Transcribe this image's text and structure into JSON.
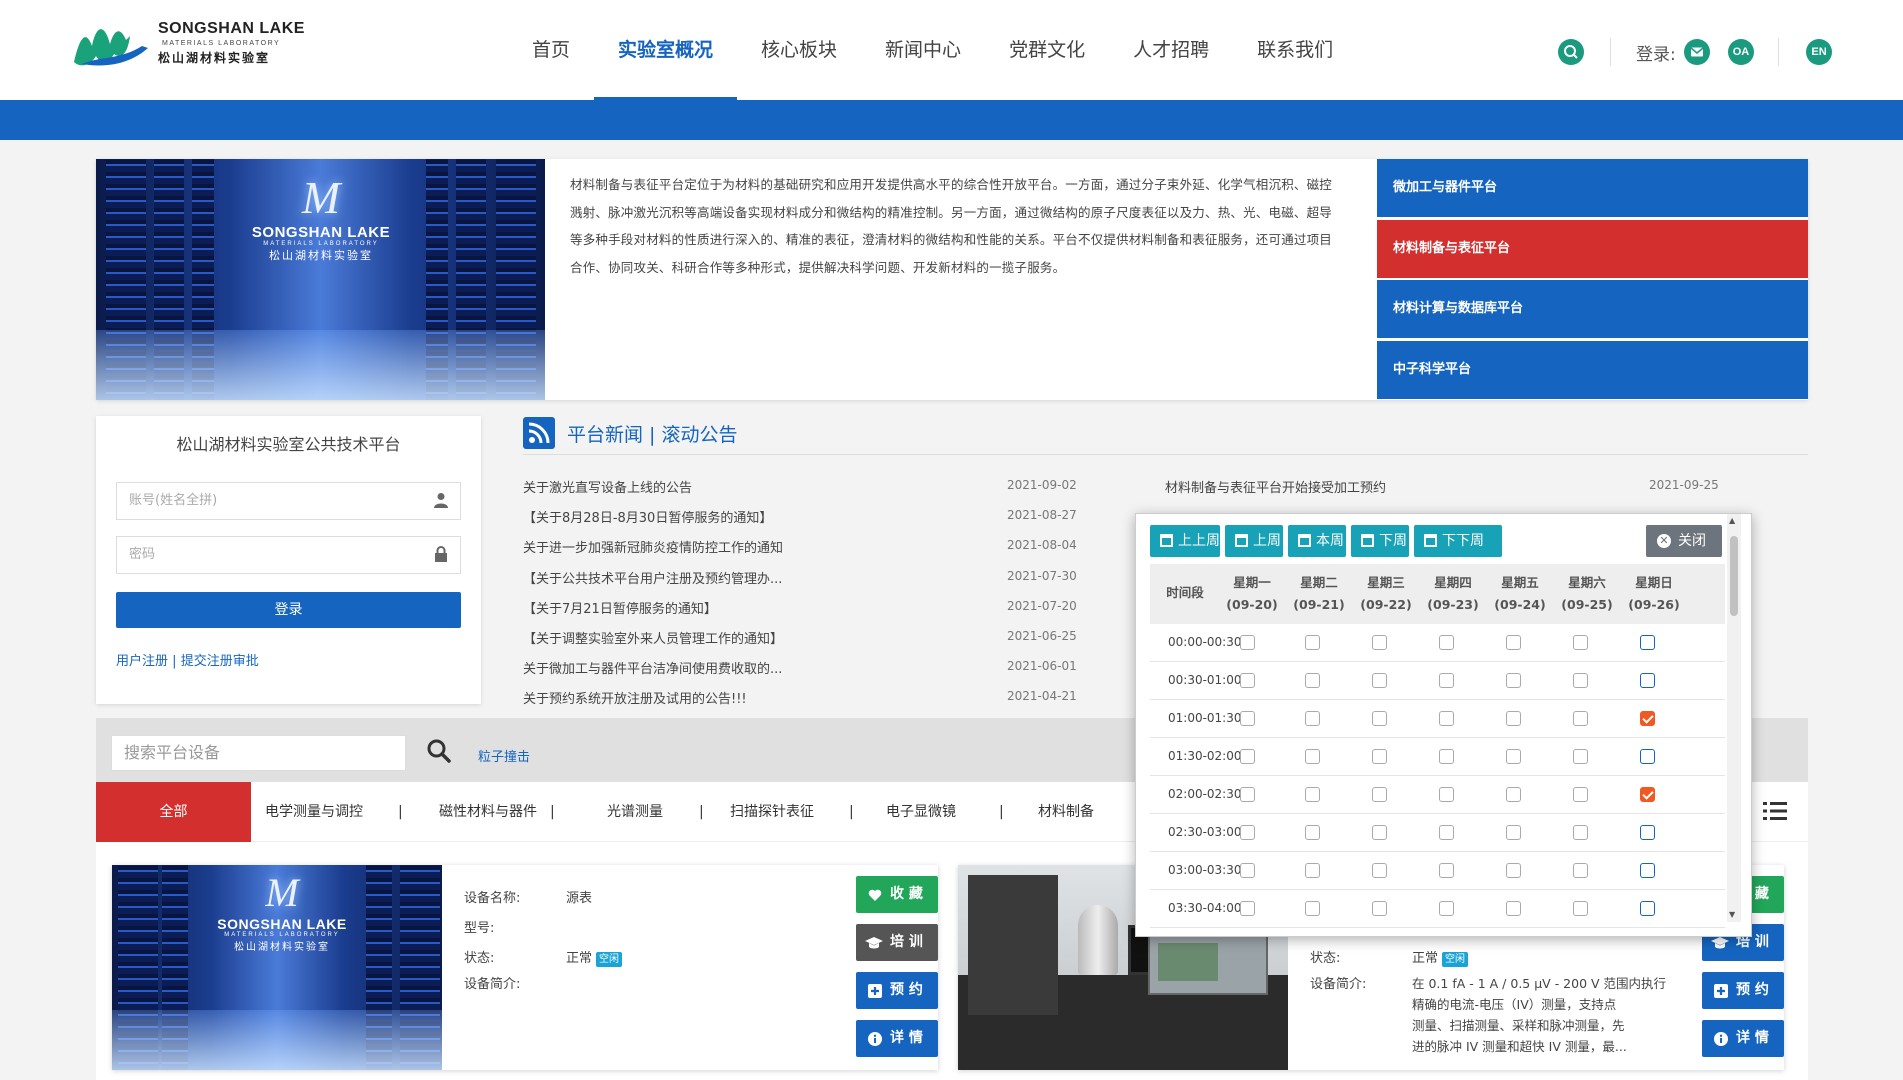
{
  "header": {
    "logo_en": "SONGSHAN LAKE",
    "logo_sub": "MATERIALS LABORATORY",
    "logo_cn": "松山湖材料实验室",
    "nav": [
      "首页",
      "实验室概况",
      "核心板块",
      "新闻中心",
      "党群文化",
      "人才招聘",
      "联系我们"
    ],
    "nav_active": "实验室概况",
    "login_label": "登录:",
    "oa_label": "OA",
    "lang_label": "EN"
  },
  "intro": {
    "image_en": "SONGSHAN LAKE",
    "image_sub": "MATERIALS LABORATORY",
    "image_cn": "松山湖材料实验室",
    "text": "材料制备与表征平台定位于为材料的基础研究和应用开发提供高水平的综合性开放平台。一方面，通过分子束外延、化学气相沉积、磁控溅射、脉冲激光沉积等高端设备实现材料成分和微结构的精准控制。另一方面，通过微结构的原子尺度表征以及力、热、光、电磁、超导等多种手段对材料的性质进行深入的、精准的表征，澄清材料的微结构和性能的关系。平台不仅提供材料制备和表征服务，还可通过项目合作、协同攻关、科研合作等多种形式，提供解决科学问题、开发新材料的一揽子服务。",
    "platforms": [
      "微加工与器件平台",
      "材料制备与表征平台",
      "材料计算与数据库平台",
      "中子科学平台"
    ],
    "active_platform": "材料制备与表征平台"
  },
  "login": {
    "title": "松山湖材料实验室公共技术平台",
    "account_placeholder": "账号(姓名全拼)",
    "password_placeholder": "密码",
    "login_button": "登录",
    "register_link": "用户注册",
    "approve_link": "提交注册审批",
    "link_sep": "|"
  },
  "news": {
    "title": "平台新闻 | 滚动公告",
    "items": [
      {
        "title": "关于激光直写设备上线的公告",
        "date": "2021-09-02"
      },
      {
        "title": "【关于8月28日-8月30日暂停服务的通知】",
        "date": "2021-08-27"
      },
      {
        "title": "关于进一步加强新冠肺炎疫情防控工作的通知",
        "date": "2021-08-04"
      },
      {
        "title": "【关于公共技术平台用户注册及预约管理办...",
        "date": "2021-07-30"
      },
      {
        "title": "【关于7月21日暂停服务的通知】",
        "date": "2021-07-20"
      },
      {
        "title": "【关于调整实验室外来人员管理工作的通知】",
        "date": "2021-06-25"
      },
      {
        "title": "关于微加工与器件平台洁净间使用费收取的...",
        "date": "2021-06-01"
      },
      {
        "title": "关于预约系统开放注册及试用的公告!!!",
        "date": "2021-04-21"
      }
    ],
    "right_item": {
      "title": "材料制备与表征平台开始接受加工预约",
      "date": "2021-09-25"
    }
  },
  "equipment": {
    "search_placeholder": "搜索平台设备",
    "search_link": "粒子撞击",
    "categories": [
      "全部",
      "电学测量与调控",
      "磁性材料与器件",
      "光谱测量",
      "扫描探针表征",
      "电子显微镜",
      "材料制备"
    ],
    "active_category": "全部",
    "cards": [
      {
        "name_label": "设备名称:",
        "name_value": "源表",
        "model_label": "型号:",
        "model_value": "",
        "status_label": "状态:",
        "status_value": "正常",
        "status_badge": "空闲",
        "desc_label": "设备简介:",
        "desc_value": ""
      },
      {
        "status_label": "状态:",
        "status_value": "正常",
        "status_badge": "空闲",
        "desc_label": "设备简介:",
        "desc_lines": [
          "在 0.1 fA - 1 A / 0.5 μV - 200 V 范围内执行",
          "精确的电流-电压（IV）测量，支持点",
          "测量、扫描测量、采样和脉冲测量，先",
          "进的脉冲 IV 测量和超快 IV 测量，最..."
        ]
      }
    ],
    "buttons": {
      "collect": "收 藏",
      "train": "培 训",
      "book": "预 约",
      "detail": "详 情"
    }
  },
  "schedule": {
    "week_buttons": [
      "上上周",
      "上周",
      "本周",
      "下周",
      "下下周"
    ],
    "close_button": "关闭",
    "time_header": "时间段",
    "days": [
      {
        "name": "星期一",
        "date": "(09-20)"
      },
      {
        "name": "星期二",
        "date": "(09-21)"
      },
      {
        "name": "星期三",
        "date": "(09-22)"
      },
      {
        "name": "星期四",
        "date": "(09-23)"
      },
      {
        "name": "星期五",
        "date": "(09-24)"
      },
      {
        "name": "星期六",
        "date": "(09-25)"
      },
      {
        "name": "星期日",
        "date": "(09-26)"
      }
    ],
    "slots": [
      {
        "time": "00:00-00:30",
        "sunday_checked": false
      },
      {
        "time": "00:30-01:00",
        "sunday_checked": false
      },
      {
        "time": "01:00-01:30",
        "sunday_checked": true
      },
      {
        "time": "01:30-02:00",
        "sunday_checked": false
      },
      {
        "time": "02:00-02:30",
        "sunday_checked": true
      },
      {
        "time": "02:30-03:00",
        "sunday_checked": false
      },
      {
        "time": "03:00-03:30",
        "sunday_checked": false
      },
      {
        "time": "03:30-04:00",
        "sunday_checked": false
      }
    ]
  },
  "colors": {
    "primary": "#1565c0",
    "active_red": "#d32f2f",
    "teal": "#17a2b8",
    "checked": "#f05a22",
    "green": "#22a65a"
  }
}
